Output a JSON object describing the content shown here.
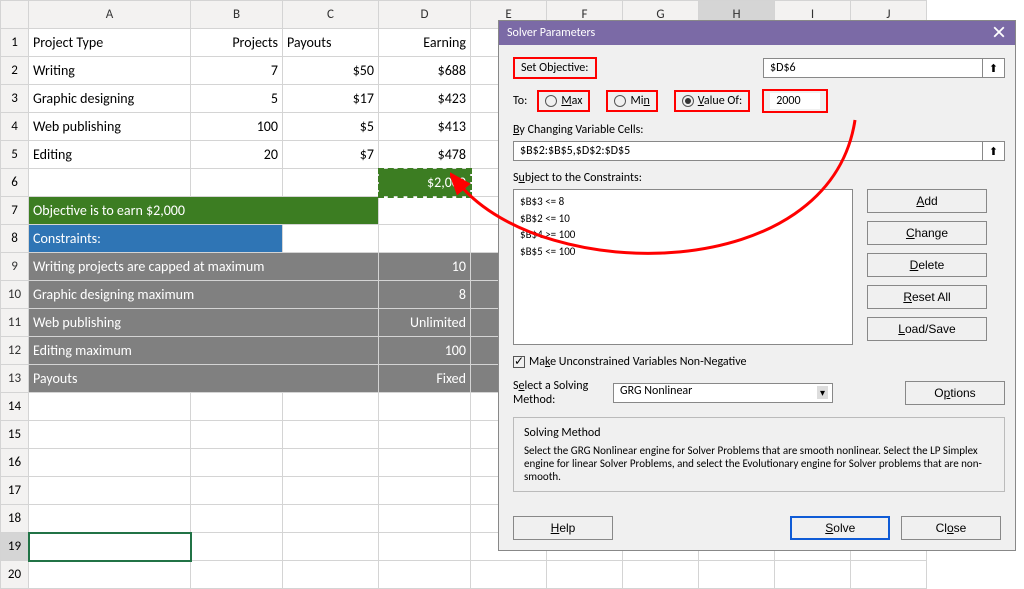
{
  "columns": [
    "A",
    "B",
    "C",
    "D",
    "E",
    "F",
    "G",
    "H",
    "I",
    "J"
  ],
  "row_headers": [
    1,
    2,
    3,
    4,
    5,
    6,
    7,
    8,
    9,
    10,
    11,
    12,
    13,
    14,
    15,
    16,
    17,
    18,
    19,
    20
  ],
  "headers": {
    "a": "Project Type",
    "b": "Projects",
    "c": "Payouts",
    "d": "Earning"
  },
  "rows": [
    {
      "a": "Writing",
      "b": "7",
      "c": "$50",
      "d": "$688"
    },
    {
      "a": "Graphic designing",
      "b": "5",
      "c": "$17",
      "d": "$423"
    },
    {
      "a": "Web publishing",
      "b": "100",
      "c": "$5",
      "d": "$413"
    },
    {
      "a": "Editing",
      "b": "20",
      "c": "$7",
      "d": "$478"
    }
  ],
  "total": "$2,000",
  "objective_text": "Objective is to earn $2,000",
  "constraints_label": "Constraints:",
  "constraint_rows": [
    {
      "a": "Writing projects are capped at maximum",
      "d": "10"
    },
    {
      "a": "Graphic designing maximum",
      "d": "8"
    },
    {
      "a": "Web publishing",
      "d": "Unlimited"
    },
    {
      "a": "Editing maximum",
      "d": "100"
    },
    {
      "a": "Payouts",
      "d": "Fixed"
    }
  ],
  "dialog": {
    "title": "Solver Parameters",
    "set_objective_lbl": "Set Objective:",
    "objective_value": "$D$6",
    "to_lbl": "To:",
    "max_lbl": "Max",
    "min_lbl": "Min",
    "valueof_lbl": "Value Of:",
    "valueof_input": "2000",
    "changing_lbl": "By Changing Variable Cells:",
    "changing_value": "$B$2:$B$5,$D$2:$D$5",
    "subject_lbl": "Subject to the Constraints:",
    "constraints": [
      "$B$3 <= 8",
      "$B$2 <= 10",
      "$B$4 >= 100",
      "$B$5 <= 100"
    ],
    "add_btn": "Add",
    "change_btn": "Change",
    "delete_btn": "Delete",
    "resetall_btn": "Reset All",
    "loadsave_btn": "Load/Save",
    "nonneg_lbl": "Make Unconstrained Variables Non-Negative",
    "method_lbl": "Select a Solving Method:",
    "method_value": "GRG Nonlinear",
    "options_btn": "Options",
    "solving_method_title": "Solving Method",
    "solving_method_text": "Select the GRG Nonlinear engine for Solver Problems that are smooth nonlinear. Select the LP Simplex engine for linear Solver Problems, and select the Evolutionary engine for Solver problems that are non-smooth.",
    "help_btn": "Help",
    "solve_btn": "Solve",
    "close_btn": "Close"
  }
}
